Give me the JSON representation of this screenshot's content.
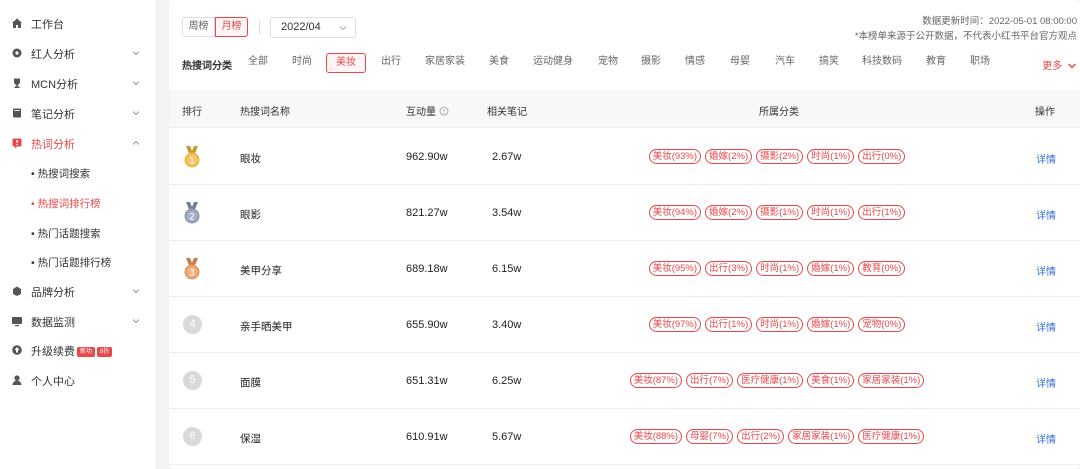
{
  "sidebar": {
    "items": [
      {
        "label": "工作台",
        "icon": "home-icon"
      },
      {
        "label": "红人分析",
        "icon": "gear-icon"
      },
      {
        "label": "MCN分析",
        "icon": "trophy-icon"
      },
      {
        "label": "笔记分析",
        "icon": "book-icon"
      },
      {
        "label": "热词分析",
        "icon": "hot-word-icon"
      },
      {
        "label": "品牌分析",
        "icon": "brand-icon"
      },
      {
        "label": "数据监测",
        "icon": "monitor-icon"
      },
      {
        "label": "升级续费",
        "icon": "upgrade-icon",
        "badge1": "新功",
        "badge2": "8折"
      },
      {
        "label": "个人中心",
        "icon": "user-icon"
      }
    ],
    "sub_items": [
      "热搜词搜索",
      "热搜词排行榜",
      "热门话题搜索",
      "热门话题排行榜"
    ]
  },
  "filters": {
    "week_label": "周榜",
    "month_label": "月榜",
    "date_value": "2022/04"
  },
  "info": {
    "update_time": "数据更新时间：2022-05-01 08:00:00",
    "note": "*本榜单来源于公开数据，不代表小红书平台官方观点"
  },
  "categories": {
    "label": "热搜词分类",
    "items": [
      "全部",
      "时尚",
      "美妆",
      "出行",
      "家居家装",
      "美食",
      "运动健身",
      "宠物",
      "摄影",
      "情感",
      "母婴",
      "汽车",
      "搞笑",
      "科技数码",
      "教育",
      "职场"
    ],
    "selected": "美妆",
    "more_label": "更多"
  },
  "table": {
    "headers": {
      "rank": "排行",
      "name": "热搜词名称",
      "interaction": "互动量",
      "notes": "相关笔记",
      "category": "所属分类",
      "action": "操作"
    },
    "detail_label": "详情",
    "rows": [
      {
        "rank": "1",
        "name": "眼妆",
        "interaction": "962.90w",
        "notes": "2.67w",
        "tags": [
          "美妆(93%)",
          "婚嫁(2%)",
          "摄影(2%)",
          "时尚(1%)",
          "出行(0%)"
        ]
      },
      {
        "rank": "2",
        "name": "眼影",
        "interaction": "821.27w",
        "notes": "3.54w",
        "tags": [
          "美妆(94%)",
          "婚嫁(2%)",
          "摄影(1%)",
          "时尚(1%)",
          "出行(1%)"
        ]
      },
      {
        "rank": "3",
        "name": "美甲分享",
        "interaction": "689.18w",
        "notes": "6.15w",
        "tags": [
          "美妆(95%)",
          "出行(3%)",
          "时尚(1%)",
          "婚嫁(1%)",
          "教育(0%)"
        ]
      },
      {
        "rank": "4",
        "name": "亲手晒美甲",
        "interaction": "655.90w",
        "notes": "3.40w",
        "tags": [
          "美妆(97%)",
          "出行(1%)",
          "时尚(1%)",
          "婚嫁(1%)",
          "宠物(0%)"
        ]
      },
      {
        "rank": "5",
        "name": "面膜",
        "interaction": "651.31w",
        "notes": "6.25w",
        "tags": [
          "美妆(87%)",
          "出行(7%)",
          "医疗健康(1%)",
          "美食(1%)",
          "家居家装(1%)"
        ]
      },
      {
        "rank": "6",
        "name": "保湿",
        "interaction": "610.91w",
        "notes": "5.67w",
        "tags": [
          "美妆(88%)",
          "母婴(7%)",
          "出行(2%)",
          "家居家装(1%)",
          "医疗健康(1%)"
        ]
      }
    ]
  },
  "colors": {
    "accent": "#e8474b",
    "link": "#2f6fd6",
    "gold": "#e8a93a",
    "silver": "#8e9bb3",
    "bronze": "#e69a62"
  }
}
